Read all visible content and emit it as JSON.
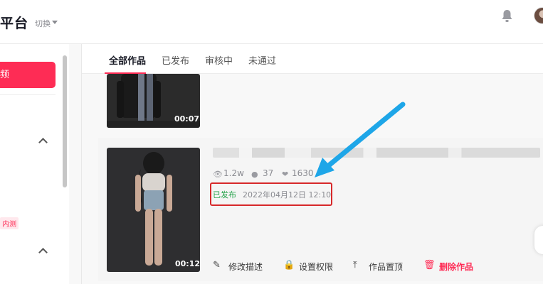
{
  "header": {
    "brand": "平台",
    "switch_label": "切换",
    "bell_icon": "bell-icon",
    "avatar_icon": "user-avatar"
  },
  "sidebar": {
    "upload_label": "频",
    "beta_badge": "内测"
  },
  "tabs": [
    {
      "label": "全部作品",
      "active": true
    },
    {
      "label": "已发布",
      "active": false
    },
    {
      "label": "审核中",
      "active": false
    },
    {
      "label": "未通过",
      "active": false
    }
  ],
  "works": [
    {
      "duration": "00:07"
    },
    {
      "duration": "00:12",
      "stats": {
        "plays": "1.2w",
        "comments": "37",
        "likes": "1630"
      },
      "status": "已发布",
      "publish_time": "2022年04月12日 12:10",
      "actions": {
        "edit": "修改描述",
        "permission": "设置权限",
        "pin": "作品置顶",
        "delete": "删除作品"
      }
    }
  ],
  "colors": {
    "accent": "#fe2c55",
    "published": "#25a34a",
    "annotation_box": "#d7282a",
    "annotation_arrow": "#1ea6e8"
  }
}
